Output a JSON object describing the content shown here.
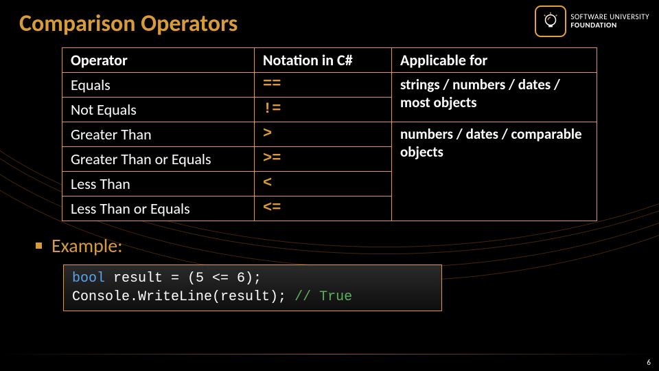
{
  "title": "Comparison Operators",
  "logo": {
    "line1": "SOFTWARE UNIVERSITY",
    "line2": "FOUNDATION"
  },
  "table": {
    "headers": [
      "Operator",
      "Notation in C#",
      "Applicable for"
    ],
    "rows": [
      {
        "op": "Equals",
        "note": "=="
      },
      {
        "op": "Not Equals",
        "note": "!="
      },
      {
        "op": "Greater Than",
        "note": ">"
      },
      {
        "op": "Greater Than or Equals",
        "note": ">="
      },
      {
        "op": "Less Than",
        "note": "<"
      },
      {
        "op": "Less Than or Equals",
        "note": "<="
      }
    ],
    "applicable": [
      "strings / numbers / dates / most objects",
      "numbers / dates / comparable objects"
    ]
  },
  "example_label": "Example:",
  "code": {
    "kw_bool": "bool",
    "l1_rest": " result = (5 <= 6);",
    "l2_call": "Console.WriteLine(result); ",
    "l2_comment": "// True"
  },
  "page_number": "6"
}
